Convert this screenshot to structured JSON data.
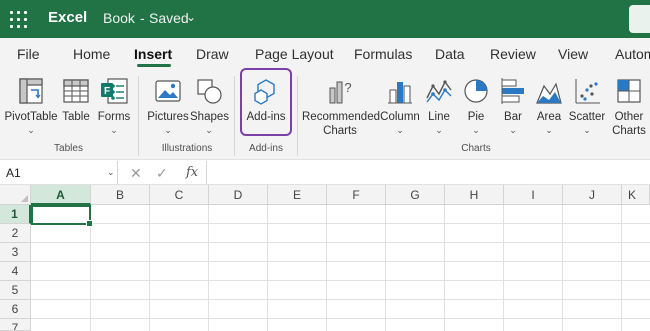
{
  "titlebar": {
    "app_name": "Excel",
    "doc_title": "Book",
    "separator": "-",
    "status": "Saved",
    "status_chevron": "⌄"
  },
  "tabs": [
    {
      "label": "File"
    },
    {
      "label": "Home"
    },
    {
      "label": "Insert",
      "active": true
    },
    {
      "label": "Draw"
    },
    {
      "label": "Page Layout"
    },
    {
      "label": "Formulas"
    },
    {
      "label": "Data"
    },
    {
      "label": "Review"
    },
    {
      "label": "View"
    },
    {
      "label": "Autom"
    }
  ],
  "ribbon": {
    "groups": {
      "tables": "Tables",
      "illustrations": "Illustrations",
      "addins": "Add-ins",
      "charts": "Charts"
    },
    "buttons": {
      "pivottable": {
        "label": "PivotTable",
        "icon": "pivottable-icon"
      },
      "table": {
        "label": "Table",
        "icon": "table-icon"
      },
      "forms": {
        "label": "Forms",
        "icon": "forms-icon"
      },
      "pictures": {
        "label": "Pictures",
        "icon": "picture-icon"
      },
      "shapes": {
        "label": "Shapes",
        "icon": "shapes-icon"
      },
      "addins": {
        "label": "Add-ins",
        "icon": "addins-icon"
      },
      "recommended": {
        "label_line1": "Recommended",
        "label_line2": "Charts",
        "icon": "recommended-charts-icon"
      },
      "column": {
        "label": "Column",
        "icon": "column-chart-icon"
      },
      "line": {
        "label": "Line",
        "icon": "line-chart-icon"
      },
      "pie": {
        "label": "Pie",
        "icon": "pie-chart-icon"
      },
      "bar": {
        "label": "Bar",
        "icon": "bar-chart-icon"
      },
      "area": {
        "label": "Area",
        "icon": "area-chart-icon"
      },
      "scatter": {
        "label": "Scatter",
        "icon": "scatter-chart-icon"
      },
      "other": {
        "label_line1": "Other",
        "label_line2": "Charts",
        "icon": "other-charts-icon"
      }
    },
    "chevron": "⌄"
  },
  "formula_bar": {
    "name_box": "A1",
    "cancel_glyph": "✕",
    "enter_glyph": "✓",
    "fx_glyph": "fx",
    "value": ""
  },
  "grid": {
    "columns": [
      "A",
      "B",
      "C",
      "D",
      "E",
      "F",
      "G",
      "H",
      "I",
      "J",
      "K"
    ],
    "rows": [
      "1",
      "2",
      "3",
      "4",
      "5",
      "6",
      "7"
    ],
    "active_cell": "A1"
  },
  "colors": {
    "brand": "#217346",
    "highlight_box": "#7b3fa8"
  }
}
